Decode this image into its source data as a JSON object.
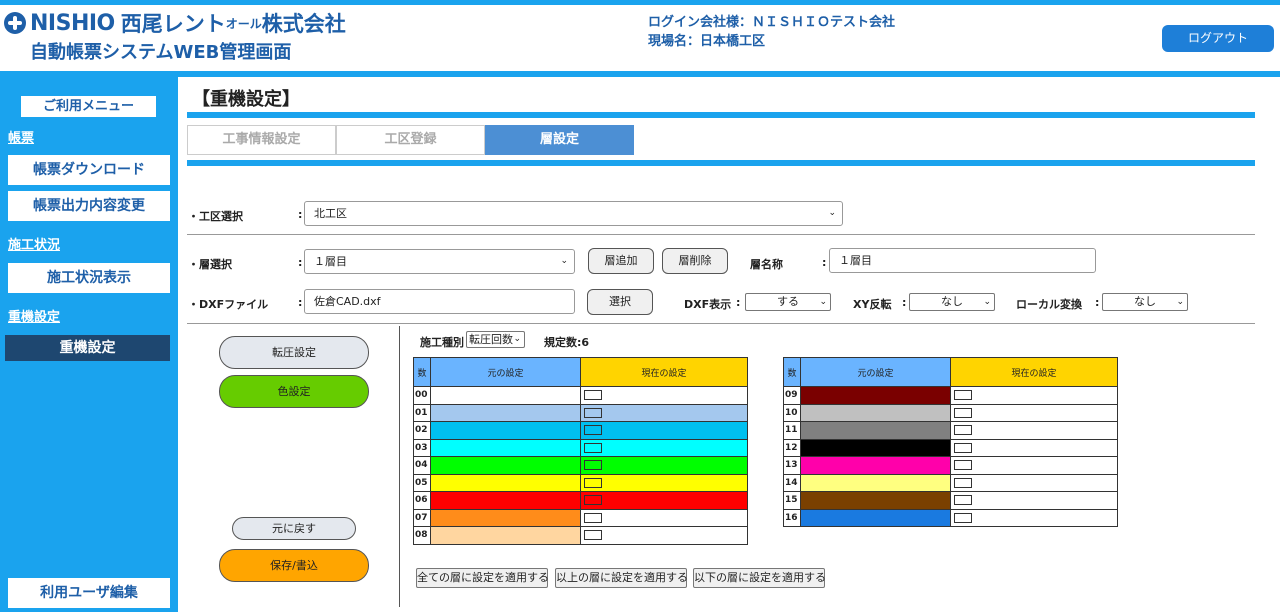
{
  "header": {
    "logo_en": "NISHIO",
    "logo_jp_a": "西尾レント",
    "logo_jp_small": "オール",
    "logo_jp_b": "株式会社",
    "system_title": "自動帳票システムWEB管理画面",
    "login_company": "ログイン会社様：ＮＩＳＨＩＯテスト会社",
    "site_name": "現場名：日本橋工区",
    "logout": "ログアウト"
  },
  "sidebar": {
    "menu_title": "ご利用メニュー",
    "section_forms": "帳票",
    "form_download": "帳票ダウンロード",
    "form_output_change": "帳票出力内容変更",
    "section_status": "施工状況",
    "status_display": "施工状況表示",
    "section_machine": "重機設定",
    "machine_setting": "重機設定",
    "user_edit": "利用ユーザ編集"
  },
  "main": {
    "title": "【重機設定】",
    "tabs": [
      "工事情報設定",
      "工区登録",
      "層設定"
    ],
    "active_tab": "層設定",
    "area_label": "・工区選択",
    "area_value": "北工区",
    "layer_label": "・層選択",
    "layer_value": "１層目",
    "layer_add": "層追加",
    "layer_delete": "層削除",
    "layer_name_label": "層名称",
    "layer_name_value": "１層目",
    "dxf_label": "・DXFファイル",
    "dxf_value": "佐倉CAD.dxf",
    "select_button": "選択",
    "dxf_display_label": "DXF表示",
    "dxf_display_value": "する",
    "xy_flip_label": "XY反転",
    "xy_flip_value": "なし",
    "local_convert_label": "ローカル変換",
    "local_convert_value": "なし",
    "colon": ":"
  },
  "left_panel": {
    "compaction_setting": "転圧設定",
    "color_setting": "色設定",
    "revert": "元に戻す",
    "save_write": "保存/書込"
  },
  "color_panel": {
    "work_type_label": "施工種別",
    "work_type_value": "転圧回数",
    "standard_count": "規定数:6",
    "headers": {
      "num": "数",
      "original": "元の設定",
      "current": "現在の設定"
    },
    "table_left": [
      {
        "num": "00",
        "original": "#ffffff",
        "current": "#ffffff",
        "swatch": "#ffffff"
      },
      {
        "num": "01",
        "original": "#a4c8ee",
        "current": "#a4c8ee",
        "swatch": "#a4c8ee"
      },
      {
        "num": "02",
        "original": "#00c0f0",
        "current": "#00c0f0",
        "swatch": "#00c0f0"
      },
      {
        "num": "03",
        "original": "#00ffff",
        "current": "#00ffff",
        "swatch": "#00ffff"
      },
      {
        "num": "04",
        "original": "#00ff00",
        "current": "#00ff00",
        "swatch": "#00ff00"
      },
      {
        "num": "05",
        "original": "#ffff00",
        "current": "#ffff00",
        "swatch": "#ffff00"
      },
      {
        "num": "06",
        "original": "#ff0000",
        "current": "#ff0000",
        "swatch": "#ff0000"
      },
      {
        "num": "07",
        "original": "#ff8c1a",
        "current": "#ffffff",
        "swatch": "#ffffff"
      },
      {
        "num": "08",
        "original": "#ffd6a0",
        "current": "#ffffff",
        "swatch": "#ffffff"
      }
    ],
    "table_right": [
      {
        "num": "09",
        "original": "#7a0000",
        "current": "#ffffff",
        "swatch": "#ffffff"
      },
      {
        "num": "10",
        "original": "#c0c0c0",
        "current": "#ffffff",
        "swatch": "#ffffff"
      },
      {
        "num": "11",
        "original": "#808080",
        "current": "#ffffff",
        "swatch": "#ffffff"
      },
      {
        "num": "12",
        "original": "#000000",
        "current": "#ffffff",
        "swatch": "#ffffff"
      },
      {
        "num": "13",
        "original": "#ff00aa",
        "current": "#ffffff",
        "swatch": "#ffffff"
      },
      {
        "num": "14",
        "original": "#ffff80",
        "current": "#ffffff",
        "swatch": "#ffffff"
      },
      {
        "num": "15",
        "original": "#7a4000",
        "current": "#ffffff",
        "swatch": "#ffffff"
      },
      {
        "num": "16",
        "original": "#1a7ae0",
        "current": "#ffffff",
        "swatch": "#ffffff"
      }
    ],
    "apply_all": "全ての層に設定を適用する",
    "apply_above": "以上の層に設定を適用する",
    "apply_below": "以下の層に設定を適用する"
  },
  "colors": {
    "accent": "#1aa3ee",
    "brand": "#1e5fa8",
    "header_original_bg": "#6ab4ff",
    "header_current_bg": "#ffd400",
    "color_setting_bg": "#66cc00",
    "save_bg": "#ffa500"
  }
}
